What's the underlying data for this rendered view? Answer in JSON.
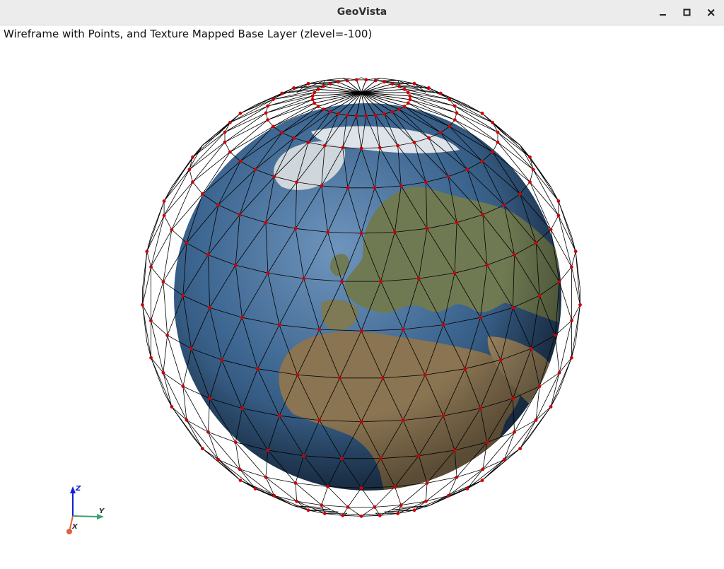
{
  "window": {
    "title": "GeoVista",
    "controls": [
      "minimize-icon",
      "maximize-icon",
      "close-icon"
    ]
  },
  "plot": {
    "subtitle": "Wireframe with Points, and Texture Mapped Base Layer (zlevel=-100)",
    "mesh_color": "#000000",
    "point_color": "#d00000",
    "ocean_color": "#3d6690",
    "land_color": "#8a7452"
  },
  "orientation_axes": {
    "z_label": "Z",
    "y_label": "Y",
    "x_label": "X",
    "z_color": "#1020d0",
    "y_color": "#3aa070",
    "x_color": "#e06040"
  }
}
